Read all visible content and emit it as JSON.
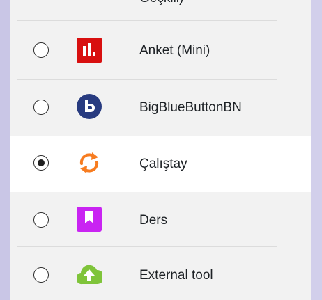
{
  "cut_off_item": {
    "label": "Geçkili)"
  },
  "items": [
    {
      "label": "Anket (Mini)",
      "icon": "bar-chart-icon",
      "icon_color": "#d80f0f",
      "selected": false
    },
    {
      "label": "BigBlueButtonBN",
      "icon": "bigbluebutton-icon",
      "icon_color": "#283b80",
      "selected": false
    },
    {
      "label": "Çalıştay",
      "icon": "refresh-arrows-icon",
      "icon_color": "#f77c20",
      "selected": true
    },
    {
      "label": "Ders",
      "icon": "bookmark-icon",
      "icon_color": "#c924f2",
      "selected": false
    },
    {
      "label": "External tool",
      "icon": "cloud-upload-icon",
      "icon_color": "#7fc43a",
      "selected": false
    }
  ]
}
